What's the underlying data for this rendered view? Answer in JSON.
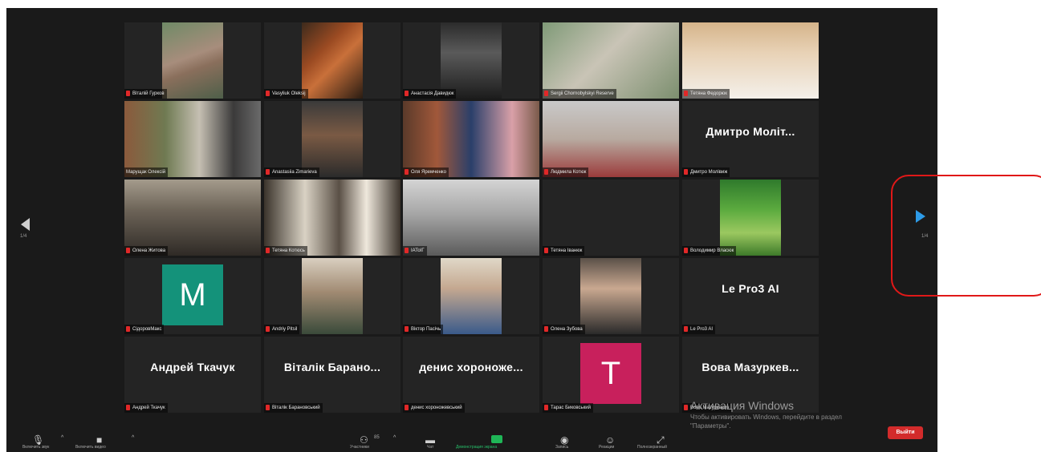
{
  "nav": {
    "left_page": "1/4",
    "right_page": "1/4"
  },
  "participants": [
    {
      "name": "Віталій Гурков"
    },
    {
      "name": "Vasyliuk Oleksij"
    },
    {
      "name": "Анастасія Давидюк"
    },
    {
      "name": "Sergii Chornobylskyi Reserve"
    },
    {
      "name": "Тетяна Федорюк"
    },
    {
      "name": "Марущак Олексій"
    },
    {
      "name": "Anastasiia Zimarieva"
    },
    {
      "name": "Оля Яремченко"
    },
    {
      "name": "Людмила Котюк"
    },
    {
      "name": "Дмитро Молівиж",
      "display": "Дмитро Моліт..."
    },
    {
      "name": "Олена Житова"
    },
    {
      "name": "Тетяна Котюсь"
    },
    {
      "name": "ІАТоІГ"
    },
    {
      "name": "Тетяна Іванюк"
    },
    {
      "name": "Володимир Власюк"
    },
    {
      "name": "СідоровМакс",
      "avatar": "M"
    },
    {
      "name": "Andriy Pitsil"
    },
    {
      "name": "Віктор Пасічь"
    },
    {
      "name": "Олена Зубова"
    },
    {
      "name": "Le Pro3 AI",
      "display": "Le Pro3 AI"
    },
    {
      "name": "Андрей Ткачук",
      "display": "Андрей Ткачук"
    },
    {
      "name": "Віталік Барановський",
      "display": "Віталік Барано..."
    },
    {
      "name": "денис хороножевський",
      "display": "денис хороноже..."
    },
    {
      "name": "Тарас Биковський",
      "avatar": "T"
    },
    {
      "name": "Вова Мазуркевич",
      "display": "Вова Мазуркев..."
    }
  ],
  "toolbar": {
    "mute": "Включить звук",
    "video": "Включить видео",
    "participants": "Участники",
    "participants_count": "85",
    "chat": "Чат",
    "share": "Демонстрация экрана",
    "record": "Запись",
    "reactions": "Реакции",
    "fullscreen": "Полноэкранный",
    "leave": "Выйти"
  },
  "watermark": {
    "title": "Активация Windows",
    "line1": "Чтобы активировать Windows, перейдите в раздел",
    "line2": "\"Параметры\"."
  },
  "colors": {
    "accent_blue": "#2d9be8",
    "leave_red": "#d32b2b",
    "avatar_green": "#14927a",
    "avatar_pink": "#c8205c"
  }
}
